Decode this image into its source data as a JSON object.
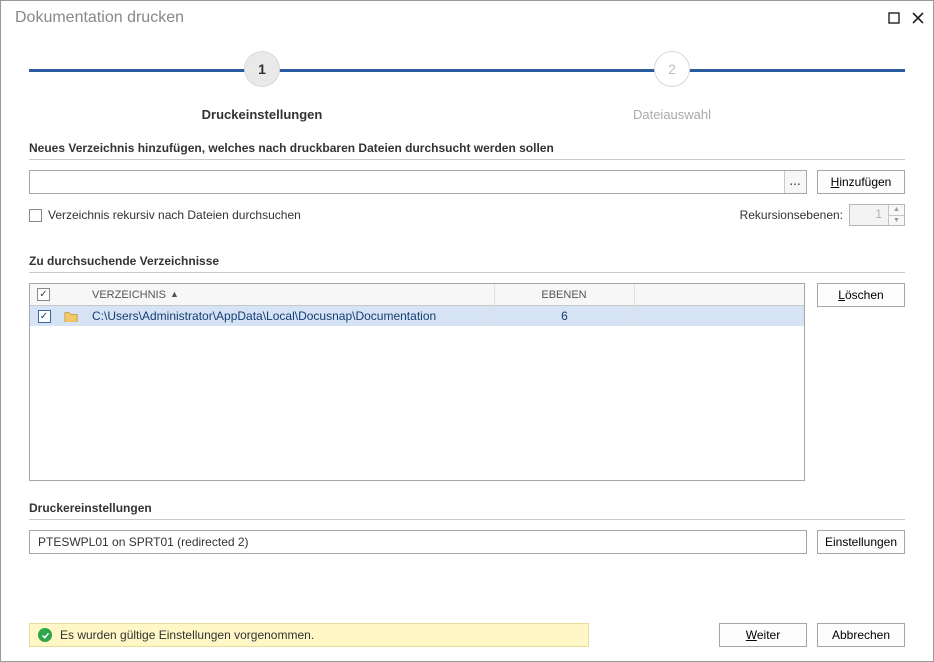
{
  "window": {
    "title": "Dokumentation drucken"
  },
  "steps": {
    "s1_num": "1",
    "s1_label": "Druckeinstellungen",
    "s2_num": "2",
    "s2_label": "Dateiauswahl"
  },
  "add_dir": {
    "heading": "Neues Verzeichnis hinzufügen, welches nach druckbaren Dateien durchsucht werden sollen",
    "path_value": "",
    "browse_glyph": "...",
    "add_label_head": "H",
    "add_label_tail": "inzufügen",
    "recursive_label": "Verzeichnis rekursiv nach Dateien durchsuchen",
    "levels_label": "Rekursionsebenen:",
    "levels_value": "1"
  },
  "dir_list": {
    "heading": "Zu durchsuchende Verzeichnisse",
    "header_check": "✓",
    "header_path": "VERZEICHNIS",
    "header_levels": "EBENEN",
    "delete_label_head": "L",
    "delete_label_tail": "öschen",
    "rows": [
      {
        "checked": "✓",
        "path": "C:\\Users\\Administrator\\AppData\\Local\\Docusnap\\Documentation",
        "levels": "6"
      }
    ]
  },
  "printer": {
    "heading": "Druckereinstellungen",
    "value": "PTESWPL01 on SPRT01 (redirected 2)",
    "settings_label": "Einstellungen"
  },
  "status": {
    "text": "Es wurden gültige Einstellungen vorgenommen."
  },
  "buttons": {
    "next_head": "W",
    "next_tail": "eiter",
    "cancel": "Abbrechen"
  }
}
